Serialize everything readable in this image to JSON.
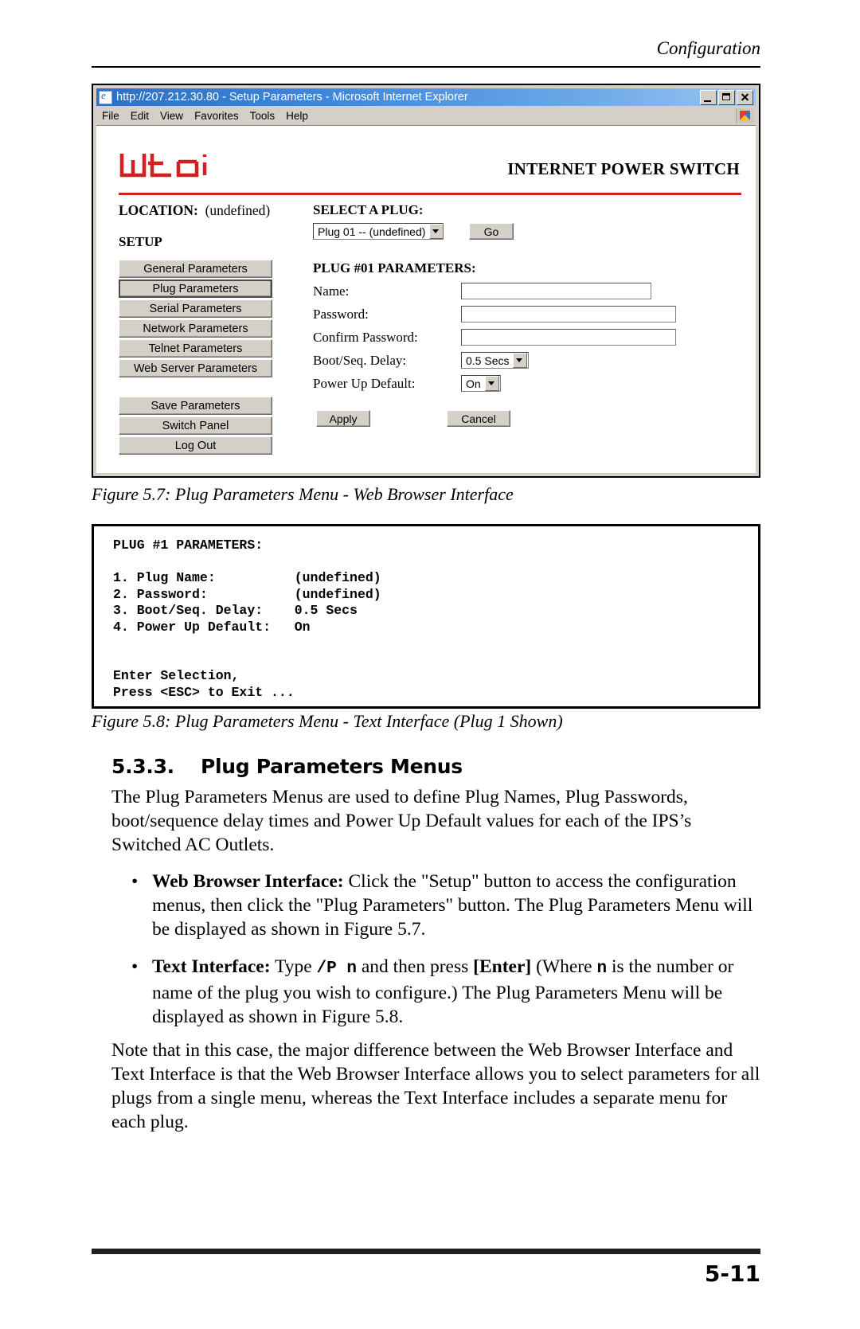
{
  "running_head": "Configuration",
  "browser_window": {
    "title": "http://207.212.30.80 - Setup Parameters - Microsoft Internet Explorer",
    "icon": "ie-document-icon",
    "window_buttons": [
      {
        "name": "minimize",
        "label": "_"
      },
      {
        "name": "maximize",
        "label": "□"
      },
      {
        "name": "close",
        "label": "×"
      }
    ],
    "menu_items": [
      "File",
      "Edit",
      "View",
      "Favorites",
      "Tools",
      "Help"
    ],
    "page": {
      "logo_alt": "wti",
      "header_title": "INTERNET POWER SWITCH",
      "location_label": "LOCATION:",
      "location_value": "(undefined)",
      "setup_label": "SETUP",
      "nav_group_1": [
        "General Parameters",
        "Plug Parameters",
        "Serial Parameters",
        "Network Parameters",
        "Telnet Parameters",
        "Web Server Parameters"
      ],
      "nav_focused_index": 1,
      "nav_group_2": [
        "Save Parameters",
        "Switch Panel",
        "Log Out"
      ],
      "select_a_plug_label": "SELECT A PLUG:",
      "plug_select_value": "Plug 01 -- (undefined)",
      "go_button": "Go",
      "plug_params_heading": "PLUG #01 PARAMETERS:",
      "fields": [
        {
          "label": "Name:",
          "value": "",
          "type": "text"
        },
        {
          "label": "Password:",
          "value": "",
          "type": "text"
        },
        {
          "label": "Confirm Password:",
          "value": "",
          "type": "text"
        },
        {
          "label": "Boot/Seq. Delay:",
          "value": "0.5 Secs",
          "type": "select"
        },
        {
          "label": "Power Up Default:",
          "value": "On",
          "type": "select"
        }
      ],
      "apply_button": "Apply",
      "cancel_button": "Cancel"
    }
  },
  "figure_57_caption": "Figure 5.7:  Plug Parameters Menu - Web Browser Interface",
  "text_interface": {
    "content": "PLUG #1 PARAMETERS:\n\n1. Plug Name:          (undefined)\n2. Password:           (undefined)\n3. Boot/Seq. Delay:    0.5 Secs\n4. Power Up Default:   On\n\n\nEnter Selection,\nPress <ESC> to Exit ..."
  },
  "figure_58_caption": "Figure 5.8:  Plug Parameters Menu - Text Interface (Plug 1 Shown)",
  "section": {
    "number": "5.3.3.",
    "title": "Plug Parameters Menus",
    "intro": "The Plug Parameters Menus are used to define Plug Names, Plug Passwords, boot/sequence delay times and Power Up Default values for each of the IPS’s Switched AC Outlets.",
    "bullets": [
      {
        "lead": "Web Browser Interface:",
        "text": "  Click the \"Setup\" button to access the configuration menus, then click the \"Plug Parameters\" button.  The Plug Parameters Menu will be displayed as shown in Figure 5.7."
      },
      {
        "lead": "Text Interface:",
        "text_1": "  Type ",
        "mono_1": "/P  n",
        "text_2": " and then press ",
        "bold_2": "[Enter]",
        "text_3": " (Where ",
        "mono_2": "n",
        "text_4": " is the number or name of the plug you wish to configure.)  The Plug Parameters Menu will be displayed as shown in Figure 5.8."
      }
    ],
    "note": "Note that in this case, the major difference between the Web Browser Interface and Text Interface is that the Web Browser Interface allows you to select parameters for all plugs from a single menu, whereas the Text Interface includes a separate menu for each plug."
  },
  "page_number": "5-11",
  "colors": {
    "brand_red": "#d21f1f",
    "titlebar_blue": "#3f86dd",
    "chrome_gray": "#d4d0c8"
  }
}
